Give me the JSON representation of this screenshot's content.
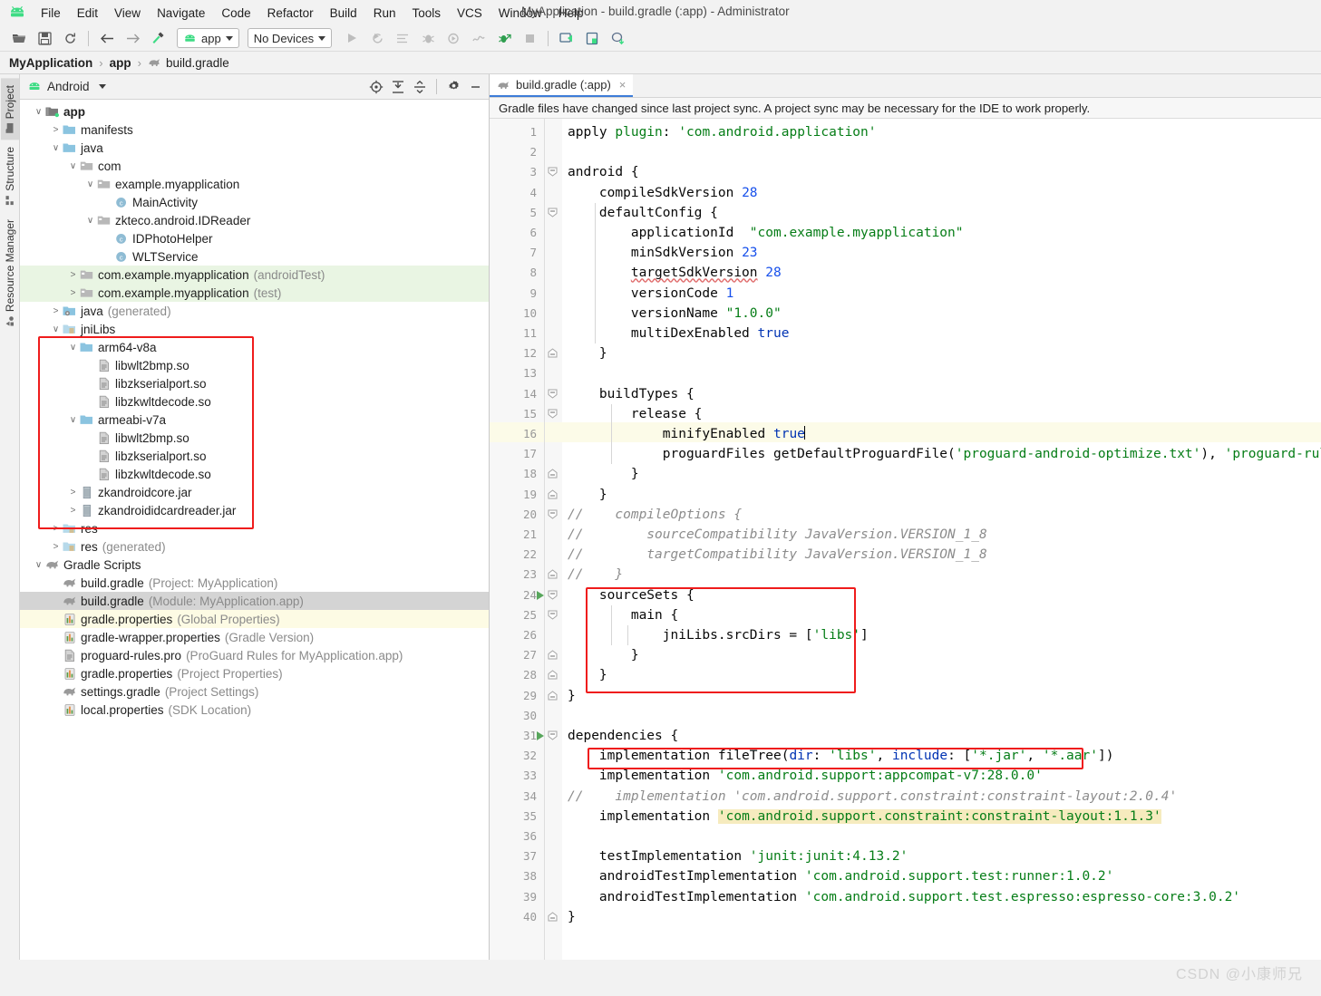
{
  "window": {
    "title": "MyApplication - build.gradle (:app) - Administrator",
    "app_icon": "android-logo-icon"
  },
  "menubar": [
    {
      "label": "File"
    },
    {
      "label": "Edit"
    },
    {
      "label": "View"
    },
    {
      "label": "Navigate"
    },
    {
      "label": "Code"
    },
    {
      "label": "Refactor"
    },
    {
      "label": "Build"
    },
    {
      "label": "Run"
    },
    {
      "label": "Tools"
    },
    {
      "label": "VCS"
    },
    {
      "label": "Window"
    },
    {
      "label": "Help"
    }
  ],
  "toolbar": {
    "module_selector": "app",
    "device_selector": "No Devices",
    "icons": [
      "open-folder-icon",
      "save-icon",
      "sync-icon",
      "back-arrow-icon",
      "forward-arrow-icon",
      "build-hammer-icon",
      "run-icon",
      "apply-changes-icon",
      "logcat-icon",
      "debug-icon",
      "run-with-coverage-icon",
      "profiler-icon",
      "attach-debugger-icon",
      "stop-icon",
      "avd-manager-icon",
      "sdk-manager-icon",
      "sync-gradle-icon"
    ]
  },
  "breadcrumb": {
    "items": [
      {
        "label": "MyApplication",
        "bold": true
      },
      {
        "label": "app",
        "bold": true
      },
      {
        "label": "build.gradle",
        "bold": false,
        "icon": "gradle-elephant-icon"
      }
    ],
    "separator": "›"
  },
  "left_rail": [
    {
      "label": "Project",
      "icon": "project-folder-icon",
      "active": true
    },
    {
      "label": "Structure",
      "icon": "structure-icon",
      "active": false
    },
    {
      "label": "Resource Manager",
      "icon": "resource-manager-icon",
      "active": false
    }
  ],
  "project_panel": {
    "view_selector": "Android",
    "actions": [
      "select-opened-file-icon",
      "expand-all-icon",
      "collapse-all-icon",
      "settings-gear-icon",
      "hide-panel-icon"
    ],
    "tree": [
      {
        "depth": 0,
        "arrow": "down",
        "icon": "module-folder-icon",
        "label": "app",
        "sub": "",
        "bold": true,
        "state": ""
      },
      {
        "depth": 1,
        "arrow": "right",
        "icon": "folder-icon",
        "label": "manifests",
        "sub": "",
        "bold": false,
        "state": ""
      },
      {
        "depth": 1,
        "arrow": "down",
        "icon": "folder-icon",
        "label": "java",
        "sub": "",
        "bold": false,
        "state": ""
      },
      {
        "depth": 2,
        "arrow": "down",
        "icon": "package-icon",
        "label": "com",
        "sub": "",
        "bold": false,
        "state": ""
      },
      {
        "depth": 3,
        "arrow": "down",
        "icon": "package-icon",
        "label": "example.myapplication",
        "sub": "",
        "bold": false,
        "state": ""
      },
      {
        "depth": 4,
        "arrow": "",
        "icon": "java-class-icon",
        "label": "MainActivity",
        "sub": "",
        "bold": false,
        "state": ""
      },
      {
        "depth": 3,
        "arrow": "down",
        "icon": "package-icon",
        "label": "zkteco.android.IDReader",
        "sub": "",
        "bold": false,
        "state": ""
      },
      {
        "depth": 4,
        "arrow": "",
        "icon": "java-class-icon",
        "label": "IDPhotoHelper",
        "sub": "",
        "bold": false,
        "state": ""
      },
      {
        "depth": 4,
        "arrow": "",
        "icon": "java-class-icon",
        "label": "WLTService",
        "sub": "",
        "bold": false,
        "state": ""
      },
      {
        "depth": 2,
        "arrow": "right",
        "icon": "package-icon",
        "label": "com.example.myapplication",
        "sub": "(androidTest)",
        "bold": false,
        "state": "green"
      },
      {
        "depth": 2,
        "arrow": "right",
        "icon": "package-icon",
        "label": "com.example.myapplication",
        "sub": "(test)",
        "bold": false,
        "state": "green"
      },
      {
        "depth": 1,
        "arrow": "right",
        "icon": "generated-folder-icon",
        "label": "java",
        "sub": "(generated)",
        "bold": false,
        "state": ""
      },
      {
        "depth": 1,
        "arrow": "down",
        "icon": "res-folder-icon",
        "label": "jniLibs",
        "sub": "",
        "bold": false,
        "state": ""
      },
      {
        "depth": 2,
        "arrow": "down",
        "icon": "folder-icon",
        "label": "arm64-v8a",
        "sub": "",
        "bold": false,
        "state": ""
      },
      {
        "depth": 3,
        "arrow": "",
        "icon": "file-icon",
        "label": "libwlt2bmp.so",
        "sub": "",
        "bold": false,
        "state": ""
      },
      {
        "depth": 3,
        "arrow": "",
        "icon": "file-icon",
        "label": "libzkserialport.so",
        "sub": "",
        "bold": false,
        "state": ""
      },
      {
        "depth": 3,
        "arrow": "",
        "icon": "file-icon",
        "label": "libzkwltdecode.so",
        "sub": "",
        "bold": false,
        "state": ""
      },
      {
        "depth": 2,
        "arrow": "down",
        "icon": "folder-icon",
        "label": "armeabi-v7a",
        "sub": "",
        "bold": false,
        "state": ""
      },
      {
        "depth": 3,
        "arrow": "",
        "icon": "file-icon",
        "label": "libwlt2bmp.so",
        "sub": "",
        "bold": false,
        "state": ""
      },
      {
        "depth": 3,
        "arrow": "",
        "icon": "file-icon",
        "label": "libzkserialport.so",
        "sub": "",
        "bold": false,
        "state": ""
      },
      {
        "depth": 3,
        "arrow": "",
        "icon": "file-icon",
        "label": "libzkwltdecode.so",
        "sub": "",
        "bold": false,
        "state": ""
      },
      {
        "depth": 2,
        "arrow": "right",
        "icon": "jar-icon",
        "label": "zkandroidcore.jar",
        "sub": "",
        "bold": false,
        "state": ""
      },
      {
        "depth": 2,
        "arrow": "right",
        "icon": "jar-icon",
        "label": "zkandroididcardreader.jar",
        "sub": "",
        "bold": false,
        "state": ""
      },
      {
        "depth": 1,
        "arrow": "right",
        "icon": "res-folder-icon",
        "label": "res",
        "sub": "",
        "bold": false,
        "state": ""
      },
      {
        "depth": 1,
        "arrow": "right",
        "icon": "res-folder-icon",
        "label": "res",
        "sub": "(generated)",
        "bold": false,
        "state": ""
      },
      {
        "depth": 0,
        "arrow": "down",
        "icon": "gradle-elephant-icon",
        "label": "Gradle Scripts",
        "sub": "",
        "bold": false,
        "state": ""
      },
      {
        "depth": 1,
        "arrow": "",
        "icon": "gradle-elephant-icon",
        "label": "build.gradle",
        "sub": "(Project: MyApplication)",
        "bold": false,
        "state": ""
      },
      {
        "depth": 1,
        "arrow": "",
        "icon": "gradle-elephant-icon",
        "label": "build.gradle",
        "sub": "(Module: MyApplication.app)",
        "bold": false,
        "state": "sel"
      },
      {
        "depth": 1,
        "arrow": "",
        "icon": "properties-icon",
        "label": "gradle.properties",
        "sub": "(Global Properties)",
        "bold": false,
        "state": "yellow"
      },
      {
        "depth": 1,
        "arrow": "",
        "icon": "properties-icon",
        "label": "gradle-wrapper.properties",
        "sub": "(Gradle Version)",
        "bold": false,
        "state": ""
      },
      {
        "depth": 1,
        "arrow": "",
        "icon": "file-icon",
        "label": "proguard-rules.pro",
        "sub": "(ProGuard Rules for MyApplication.app)",
        "bold": false,
        "state": ""
      },
      {
        "depth": 1,
        "arrow": "",
        "icon": "properties-icon",
        "label": "gradle.properties",
        "sub": "(Project Properties)",
        "bold": false,
        "state": ""
      },
      {
        "depth": 1,
        "arrow": "",
        "icon": "gradle-elephant-icon",
        "label": "settings.gradle",
        "sub": "(Project Settings)",
        "bold": false,
        "state": ""
      },
      {
        "depth": 1,
        "arrow": "",
        "icon": "properties-icon",
        "label": "local.properties",
        "sub": "(SDK Location)",
        "bold": false,
        "state": ""
      }
    ]
  },
  "editor": {
    "tab": {
      "label": "build.gradle (:app)",
      "icon": "gradle-elephant-icon",
      "close": "×"
    },
    "notification": "Gradle files have changed since last project sync. A project sync may be necessary for the IDE to work properly.",
    "highlighted_line": 16,
    "total_lines": 40,
    "lines": [
      {
        "n": 1,
        "text": "apply plugin: 'com.android.application'"
      },
      {
        "n": 2,
        "text": ""
      },
      {
        "n": 3,
        "text": "android {"
      },
      {
        "n": 4,
        "text": "    compileSdkVersion 28"
      },
      {
        "n": 5,
        "text": "    defaultConfig {"
      },
      {
        "n": 6,
        "text": "        applicationId  \"com.example.myapplication\""
      },
      {
        "n": 7,
        "text": "        minSdkVersion 23"
      },
      {
        "n": 8,
        "text": "        targetSdkVersion 28"
      },
      {
        "n": 9,
        "text": "        versionCode 1"
      },
      {
        "n": 10,
        "text": "        versionName \"1.0.0\""
      },
      {
        "n": 11,
        "text": "        multiDexEnabled true"
      },
      {
        "n": 12,
        "text": "    }"
      },
      {
        "n": 13,
        "text": ""
      },
      {
        "n": 14,
        "text": "    buildTypes {"
      },
      {
        "n": 15,
        "text": "        release {"
      },
      {
        "n": 16,
        "text": "            minifyEnabled true"
      },
      {
        "n": 17,
        "text": "            proguardFiles getDefaultProguardFile('proguard-android-optimize.txt'), 'proguard-rules.pro'"
      },
      {
        "n": 18,
        "text": "        }"
      },
      {
        "n": 19,
        "text": "    }"
      },
      {
        "n": 20,
        "text": "//    compileOptions {"
      },
      {
        "n": 21,
        "text": "//        sourceCompatibility JavaVersion.VERSION_1_8"
      },
      {
        "n": 22,
        "text": "//        targetCompatibility JavaVersion.VERSION_1_8"
      },
      {
        "n": 23,
        "text": "//    }"
      },
      {
        "n": 24,
        "text": "    sourceSets {"
      },
      {
        "n": 25,
        "text": "        main {"
      },
      {
        "n": 26,
        "text": "            jniLibs.srcDirs = ['libs']"
      },
      {
        "n": 27,
        "text": "        }"
      },
      {
        "n": 28,
        "text": "    }"
      },
      {
        "n": 29,
        "text": "}"
      },
      {
        "n": 30,
        "text": ""
      },
      {
        "n": 31,
        "text": "dependencies {"
      },
      {
        "n": 32,
        "text": "    implementation fileTree(dir: 'libs', include: ['*.jar', '*.aar'])"
      },
      {
        "n": 33,
        "text": "    implementation 'com.android.support:appcompat-v7:28.0.0'"
      },
      {
        "n": 34,
        "text": "//    implementation 'com.android.support.constraint:constraint-layout:2.0.4'"
      },
      {
        "n": 35,
        "text": "    implementation 'com.android.support.constraint:constraint-layout:1.1.3'"
      },
      {
        "n": 36,
        "text": ""
      },
      {
        "n": 37,
        "text": "    testImplementation 'junit:junit:4.13.2'"
      },
      {
        "n": 38,
        "text": "    androidTestImplementation 'com.android.support.test:runner:1.0.2'"
      },
      {
        "n": 39,
        "text": "    androidTestImplementation 'com.android.support.test.espresso:espresso-core:3.0.2'"
      },
      {
        "n": 40,
        "text": "}"
      }
    ]
  },
  "annotations": {
    "box_color": "#ef1c1c",
    "boxes": [
      {
        "name": "jnilibs-highlight-box"
      },
      {
        "name": "sourcesets-highlight-box"
      },
      {
        "name": "filetree-dependency-highlight-box"
      }
    ]
  },
  "watermark": "CSDN @小康师兄",
  "colors": {
    "accent_blue": "#3d7cd8",
    "android_green": "#3ddc84",
    "string_green": "#067d17",
    "keyword_blue": "#0033b3",
    "number_blue": "#1750eb",
    "comment_grey": "#8c8c8c",
    "selection_grey": "#d4d4d4",
    "test_source_green": "#e9f5e3",
    "modified_yellow": "#fdfbe4"
  }
}
